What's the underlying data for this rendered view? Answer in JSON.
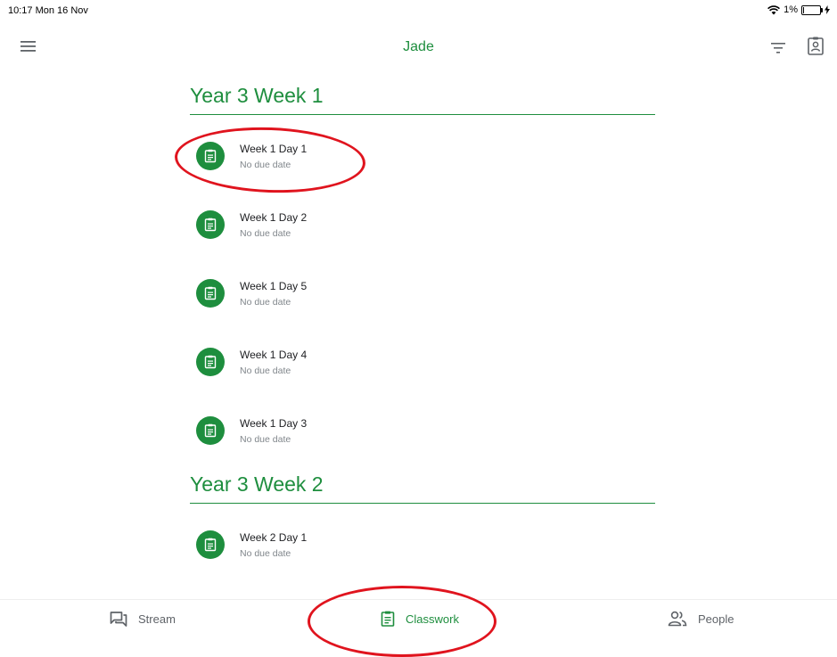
{
  "status_bar": {
    "time": "10:17 Mon 16 Nov",
    "battery": "1%",
    "battery_level": 0.01
  },
  "app_bar": {
    "class_title": "Jade"
  },
  "topics": [
    {
      "title": "Year 3 Week 1",
      "assignments": [
        {
          "title": "Week 1 Day 1",
          "due": "No due date"
        },
        {
          "title": "Week 1 Day 2",
          "due": "No due date"
        },
        {
          "title": "Week 1 Day 5",
          "due": "No due date"
        },
        {
          "title": "Week 1 Day 4",
          "due": "No due date"
        },
        {
          "title": "Week 1 Day 3",
          "due": "No due date"
        }
      ]
    },
    {
      "title": "Year 3 Week 2",
      "assignments": [
        {
          "title": "Week 2 Day 1",
          "due": "No due date"
        }
      ]
    }
  ],
  "bottom_nav": {
    "stream": "Stream",
    "classwork": "Classwork",
    "people": "People",
    "active": "classwork"
  },
  "colors": {
    "accent": "#1e8e3e",
    "annotation": "#e0141e",
    "muted": "#80868b"
  },
  "icons": {
    "menu": "menu-icon",
    "filter": "filter-icon",
    "portfolio": "portfolio-icon",
    "assignment": "assignment-icon",
    "stream": "stream-icon",
    "classwork": "classwork-icon",
    "people": "people-icon",
    "wifi": "wifi-icon",
    "battery": "battery-icon"
  }
}
